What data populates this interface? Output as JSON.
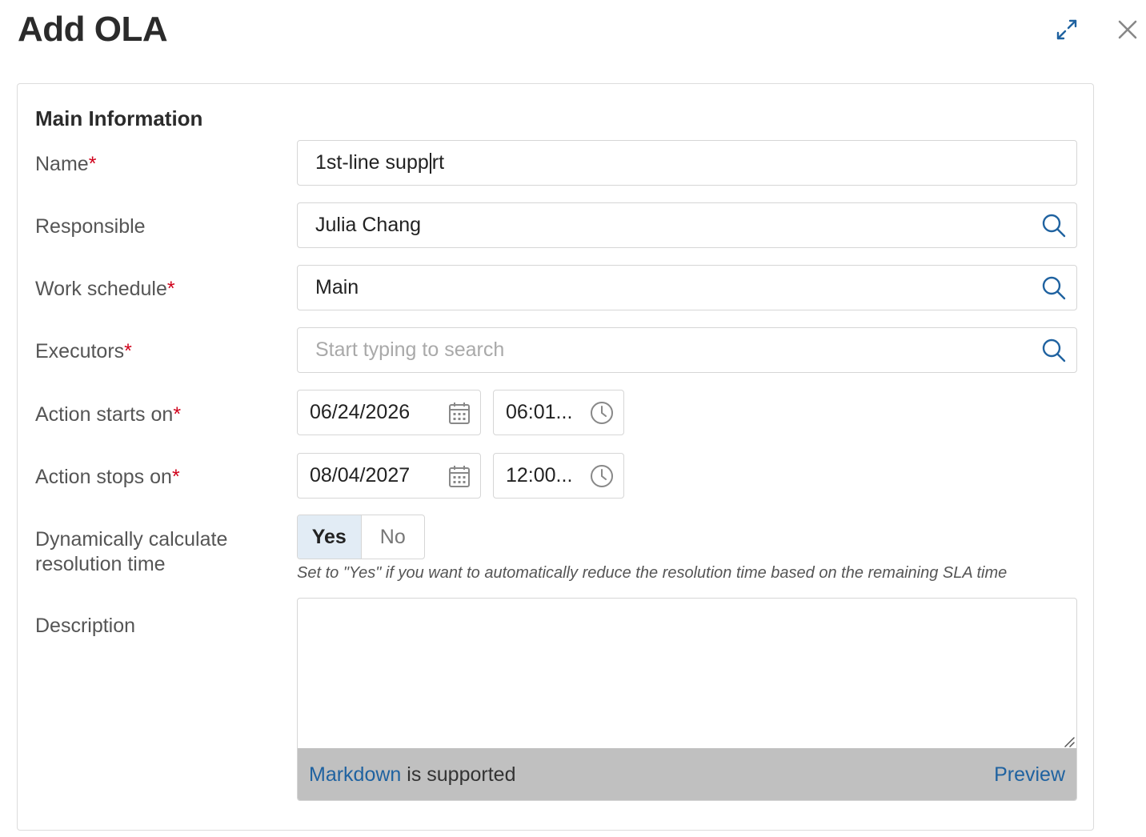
{
  "dialog": {
    "title": "Add OLA",
    "expand_icon": "expand-icon",
    "close_icon": "close-icon"
  },
  "section": {
    "title": "Main Information"
  },
  "fields": {
    "name": {
      "label": "Name",
      "required": "*",
      "value_before_cursor": "1st-line supp",
      "value_after_cursor": "rt"
    },
    "responsible": {
      "label": "Responsible",
      "value": "Julia Chang",
      "icon": "search-icon"
    },
    "work_schedule": {
      "label": "Work schedule",
      "required": "*",
      "value": "Main",
      "icon": "search-icon"
    },
    "executors": {
      "label": "Executors",
      "required": "*",
      "placeholder": "Start typing to search",
      "icon": "search-icon"
    },
    "action_starts_on": {
      "label": "Action starts on",
      "required": "*",
      "date": "06/24/2026",
      "time": "06:01...",
      "date_icon": "calendar-icon",
      "time_icon": "clock-icon"
    },
    "action_stops_on": {
      "label": "Action stops on",
      "required": "*",
      "date": "08/04/2027",
      "time": "12:00...",
      "date_icon": "calendar-icon",
      "time_icon": "clock-icon"
    },
    "dynamic_resolution": {
      "label_line1": "Dynamically calculate",
      "label_line2": "resolution time",
      "options": [
        "Yes",
        "No"
      ],
      "selected": "Yes",
      "hint": "Set to \"Yes\" if you want to automatically reduce the resolution time based on the remaining SLA time"
    },
    "description": {
      "label": "Description",
      "value": "",
      "footer_link": "Markdown",
      "footer_text": " is supported",
      "preview_label": "Preview"
    }
  },
  "colors": {
    "accent": "#1f62a0",
    "required": "#d0021b",
    "toggle_selected_bg": "#e2ecf5",
    "footer_bg": "#c0c0c0"
  }
}
